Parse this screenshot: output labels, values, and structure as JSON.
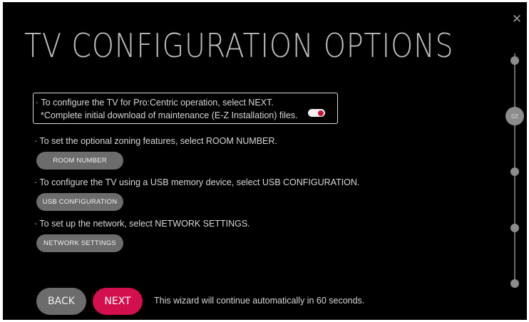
{
  "window": {
    "close_icon": "close-icon"
  },
  "title": "TV CONFIGURATION OPTIONS",
  "option_next": {
    "line1": "· To configure the TV for Pro:Centric operation, select NEXT.",
    "line2": "*Complete initial download of maintenance (E-Z Installation) files.",
    "toggle_on": true
  },
  "option_room": {
    "text": "· To set the optional zoning features, select ROOM NUMBER.",
    "button": "ROOM NUMBER"
  },
  "option_usb": {
    "text": "· To configure the TV using a USB memory device, select USB CONFIGURATION.",
    "button": "USB CONFIGURATION"
  },
  "option_network": {
    "text": "· To set up the network, select NETWORK SETTINGS.",
    "button": "NETWORK SETTINGS"
  },
  "footer": {
    "back": "BACK",
    "next": "NEXT",
    "message": "This wizard will continue automatically in 60 seconds."
  },
  "steps": {
    "current_label": "02"
  },
  "colors": {
    "background": "#000000",
    "accent": "#d30f4e",
    "button_gray": "#6c6c6c"
  }
}
